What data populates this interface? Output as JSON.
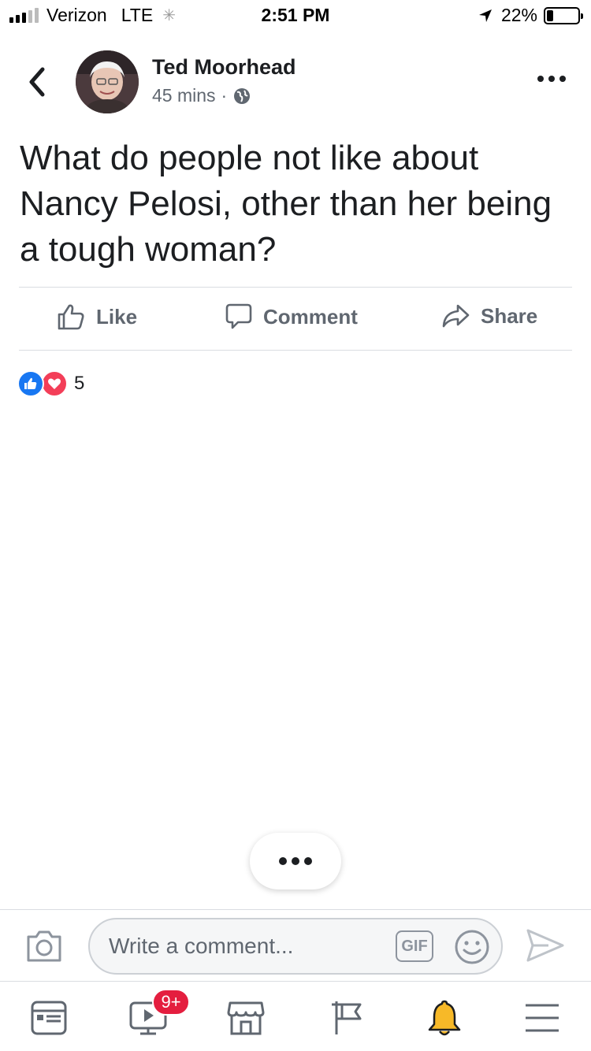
{
  "status_bar": {
    "carrier": "Verizon",
    "network": "LTE",
    "time": "2:51 PM",
    "battery": "22%",
    "battery_level": 0.22
  },
  "post": {
    "author": "Ted Moorhead",
    "time_ago": "45 mins",
    "separator": "·",
    "privacy_icon": "globe-icon",
    "text": "What do people not like about Nancy Pelosi, other than her being a tough woman?"
  },
  "actions": {
    "like": "Like",
    "comment": "Comment",
    "share": "Share"
  },
  "reactions": {
    "types": [
      "like",
      "love"
    ],
    "count": "5"
  },
  "comment_bar": {
    "placeholder": "Write a comment...",
    "gif_label": "GIF"
  },
  "tab_bar": {
    "tabs": [
      "news-feed-icon",
      "watch-icon",
      "marketplace-icon",
      "pages-icon",
      "notifications-icon",
      "menu-icon"
    ],
    "watch_badge": "9+",
    "active_tab": "notifications-icon"
  },
  "colors": {
    "accent": "#1877f2",
    "love": "#f33e58",
    "badge": "#e41e3f",
    "notification_bell": "#f7b928"
  }
}
